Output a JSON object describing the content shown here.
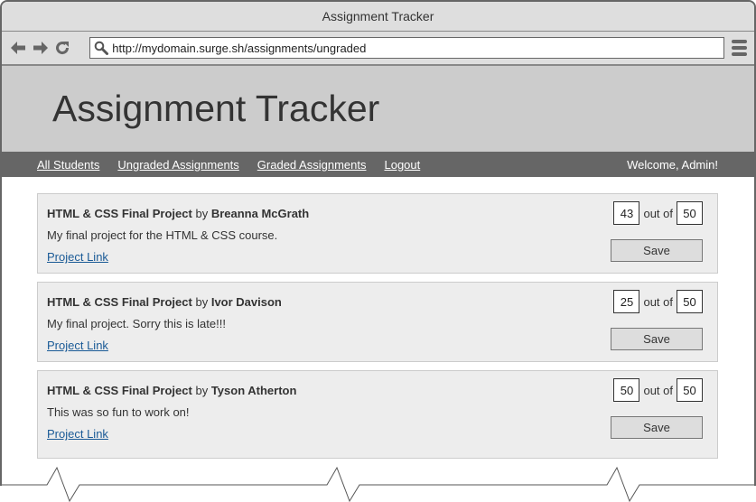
{
  "browser": {
    "window_title": "Assignment Tracker",
    "url": "http://mydomain.surge.sh/assignments/ungraded",
    "icons": {
      "back": "arrow-left-icon",
      "forward": "arrow-right-icon",
      "reload": "reload-icon",
      "search": "search-icon",
      "menu": "hamburger-menu-icon"
    }
  },
  "header": {
    "title": "Assignment Tracker"
  },
  "nav": {
    "links": [
      {
        "label": "All Students"
      },
      {
        "label": "Ungraded Assignments"
      },
      {
        "label": "Graded Assignments"
      },
      {
        "label": "Logout"
      }
    ],
    "welcome": "Welcome, Admin!"
  },
  "assignments": [
    {
      "title": "HTML & CSS Final Project",
      "by": "by",
      "student": "Breanna McGrath",
      "description": "My final project for the HTML & CSS course.",
      "link_label": "Project Link",
      "score": "43",
      "out_of_label": "out of",
      "max_score": "50",
      "save_label": "Save"
    },
    {
      "title": "HTML & CSS Final Project",
      "by": "by",
      "student": "Ivor Davison",
      "description": "My final project. Sorry this is late!!!",
      "link_label": "Project Link",
      "score": "25",
      "out_of_label": "out of",
      "max_score": "50",
      "save_label": "Save"
    },
    {
      "title": "HTML & CSS Final Project",
      "by": "by",
      "student": "Tyson Atherton",
      "description": "This was so fun to work on!",
      "link_label": "Project Link",
      "score": "50",
      "out_of_label": "out of",
      "max_score": "50",
      "save_label": "Save"
    }
  ],
  "colors": {
    "header_bg": "#cccccc",
    "nav_bg": "#666666",
    "card_bg": "#ededed",
    "link": "#1a5a96"
  }
}
